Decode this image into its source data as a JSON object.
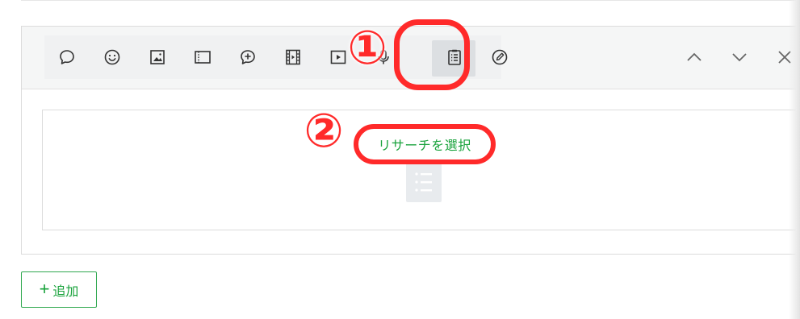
{
  "toolbar": {
    "tools": [
      {
        "icon": "speech-bubble-icon"
      },
      {
        "icon": "smiley-icon"
      },
      {
        "icon": "image-icon"
      },
      {
        "icon": "card-icon"
      },
      {
        "icon": "add-bubble-icon"
      },
      {
        "icon": "film-icon"
      },
      {
        "icon": "video-play-icon"
      },
      {
        "icon": "microphone-icon"
      },
      {
        "icon": "clipboard-list-icon",
        "active": true
      },
      {
        "icon": "pencil-circle-icon"
      }
    ],
    "nav": [
      {
        "icon": "chevron-up-icon"
      },
      {
        "icon": "chevron-down-icon"
      },
      {
        "icon": "close-icon"
      }
    ]
  },
  "annotations": {
    "step1": "①",
    "step2": "②",
    "highlight_color": "#ff2a2a"
  },
  "content": {
    "select_research_label": "リサーチを選択"
  },
  "footer": {
    "add_plus": "+",
    "add_label": "追加"
  },
  "colors": {
    "accent_green": "#18a23b",
    "panel_header_bg": "#f5f6f6",
    "toolbar_bg": "#f0f1f2"
  }
}
